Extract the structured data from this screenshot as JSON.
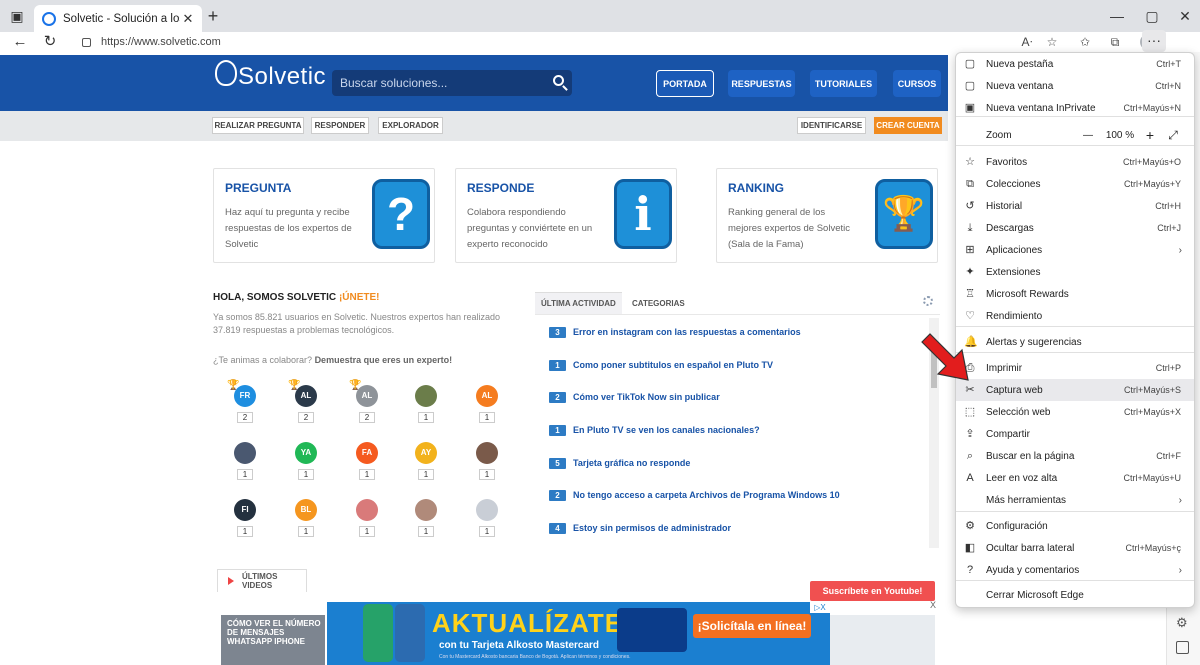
{
  "browser": {
    "tab_title": "Solvetic - Solución a los problem",
    "tab_close": "✕",
    "new_tab": "+",
    "url": "https://www.solvetic.com",
    "more_label": "···"
  },
  "site": {
    "logo": "Solvetic",
    "search_placeholder": "Buscar soluciones...",
    "nav": [
      "PORTADA",
      "RESPUESTAS",
      "TUTORIALES",
      "CURSOS"
    ],
    "subnav": [
      "REALIZAR PREGUNTA",
      "RESPONDER",
      "EXPLORADOR"
    ],
    "identificarse": "IDENTIFICARSE",
    "crear_cuenta": "CREAR CUENTA",
    "colors": {
      "header": "#1853a7",
      "accent": "#f18b1f"
    }
  },
  "cards": [
    {
      "title": "PREGUNTA",
      "desc": "Haz aquí tu pregunta y recibe respuestas de los expertos de Solvetic",
      "icon": "?"
    },
    {
      "title": "RESPONDE",
      "desc": "Colabora respondiendo preguntas y conviértete en un experto reconocido",
      "icon": "i"
    },
    {
      "title": "RANKING",
      "desc": "Ranking general de los mejores expertos de Solvetic (Sala de la Fama)",
      "icon": "🏆"
    }
  ],
  "hola": {
    "title": "HOLA, SOMOS SOLVETIC ",
    "join": "¡ÚNETE!",
    "desc": "Ya somos 85.821 usuarios en Solvetic. Nuestros expertos han realizado 37.819 respuestas a problemas tecnológicos.",
    "question": "¿Te animas a colaborar? ",
    "question_bold": "Demuestra que eres un experto!"
  },
  "users": [
    {
      "initials": "FR",
      "color": "#1e8ee0",
      "count": "2",
      "trophy": "gold"
    },
    {
      "initials": "AL",
      "color": "#2b3a4a",
      "count": "2",
      "trophy": "silver"
    },
    {
      "initials": "AL",
      "color": "#8e9399",
      "count": "2",
      "trophy": "bronze"
    },
    {
      "initials": "",
      "color": "#6b7d4a",
      "count": "1",
      "trophy": ""
    },
    {
      "initials": "AL",
      "color": "#f57c1f",
      "count": "1",
      "trophy": ""
    },
    {
      "initials": "",
      "color": "#4a5870",
      "count": "1",
      "trophy": ""
    },
    {
      "initials": "YA",
      "color": "#20b856",
      "count": "1",
      "trophy": ""
    },
    {
      "initials": "FA",
      "color": "#f55a1f",
      "count": "1",
      "trophy": ""
    },
    {
      "initials": "AY",
      "color": "#f2b21c",
      "count": "1",
      "trophy": ""
    },
    {
      "initials": "",
      "color": "#7a5a4a",
      "count": "1",
      "trophy": ""
    },
    {
      "initials": "FI",
      "color": "#24313f",
      "count": "1",
      "trophy": ""
    },
    {
      "initials": "BL",
      "color": "#f5961f",
      "count": "1",
      "trophy": ""
    },
    {
      "initials": "",
      "color": "#d97a7a",
      "count": "1",
      "trophy": ""
    },
    {
      "initials": "",
      "color": "#b08a7a",
      "count": "1",
      "trophy": ""
    },
    {
      "initials": "",
      "color": "#c9ced6",
      "count": "1",
      "trophy": ""
    }
  ],
  "activity": {
    "tabs": [
      "ÚLTIMA ACTIVIDAD",
      "CATEGORIAS"
    ],
    "items": [
      {
        "n": "3",
        "text": "Error en instagram con las respuestas a comentarios"
      },
      {
        "n": "1",
        "text": "Como poner subtitulos en español en Pluto TV"
      },
      {
        "n": "2",
        "text": "Cómo ver TikTok Now sin publicar"
      },
      {
        "n": "1",
        "text": "En Pluto TV se ven los canales nacionales?"
      },
      {
        "n": "5",
        "text": "Tarjeta gráfica no responde"
      },
      {
        "n": "2",
        "text": "No tengo acceso a carpeta Archivos de Programa Windows 10"
      },
      {
        "n": "4",
        "text": "Estoy sin permisos de administrador"
      }
    ]
  },
  "videos": {
    "tab": "ÚLTIMOS VIDEOS",
    "youtube": "Suscríbete en Youtube!",
    "thumb1": "CÓMO VER EL NÚMERO DE MENSAJES WHATSAPP IPHONE"
  },
  "ad": {
    "headline": "AKTUALÍZATE",
    "sub": "con tu Tarjeta Alkosto Mastercard",
    "fine": "Con tu Mastercard Alkosto bancaria Banco de Bogotá. Aplican términos y condiciones.",
    "cta": "¡Solicítala en línea!",
    "close": "X",
    "adchoices": "▷X"
  },
  "menu": {
    "items": [
      {
        "icon": "▢",
        "label": "Nueva pestaña",
        "shortcut": "Ctrl+T"
      },
      {
        "icon": "▢",
        "label": "Nueva ventana",
        "shortcut": "Ctrl+N"
      },
      {
        "icon": "▣",
        "label": "Nueva ventana InPrivate",
        "shortcut": "Ctrl+Mayús+N"
      },
      {
        "icon": "",
        "label": "Zoom",
        "shortcut": ""
      },
      {
        "icon": "☆",
        "label": "Favoritos",
        "shortcut": "Ctrl+Mayús+O"
      },
      {
        "icon": "⧉",
        "label": "Colecciones",
        "shortcut": "Ctrl+Mayús+Y"
      },
      {
        "icon": "↺",
        "label": "Historial",
        "shortcut": "Ctrl+H"
      },
      {
        "icon": "⤓",
        "label": "Descargas",
        "shortcut": "Ctrl+J"
      },
      {
        "icon": "⊞",
        "label": "Aplicaciones",
        "shortcut": "",
        "chevron": "›"
      },
      {
        "icon": "✦",
        "label": "Extensiones",
        "shortcut": ""
      },
      {
        "icon": "♖",
        "label": "Microsoft Rewards",
        "shortcut": ""
      },
      {
        "icon": "♡",
        "label": "Rendimiento",
        "shortcut": ""
      },
      {
        "icon": "🔔",
        "label": "Alertas y sugerencias",
        "shortcut": ""
      },
      {
        "icon": "⎙",
        "label": "Imprimir",
        "shortcut": "Ctrl+P"
      },
      {
        "icon": "✂",
        "label": "Captura web",
        "shortcut": "Ctrl+Mayús+S"
      },
      {
        "icon": "⬚",
        "label": "Selección web",
        "shortcut": "Ctrl+Mayús+X"
      },
      {
        "icon": "⇪",
        "label": "Compartir",
        "shortcut": ""
      },
      {
        "icon": "⌕",
        "label": "Buscar en la página",
        "shortcut": "Ctrl+F"
      },
      {
        "icon": "A",
        "label": "Leer en voz alta",
        "shortcut": "Ctrl+Mayús+U"
      },
      {
        "icon": "",
        "label": "Más herramientas",
        "shortcut": "",
        "chevron": "›"
      },
      {
        "icon": "⚙",
        "label": "Configuración",
        "shortcut": ""
      },
      {
        "icon": "◧",
        "label": "Ocultar barra lateral",
        "shortcut": "Ctrl+Mayús+ç"
      },
      {
        "icon": "?",
        "label": "Ayuda y comentarios",
        "shortcut": "",
        "chevron": "›"
      },
      {
        "icon": "",
        "label": "Cerrar Microsoft Edge",
        "shortcut": ""
      }
    ],
    "zoom_minus": "—",
    "zoom_value": "100 %",
    "zoom_plus": "+",
    "zoom_full": "⤢"
  }
}
